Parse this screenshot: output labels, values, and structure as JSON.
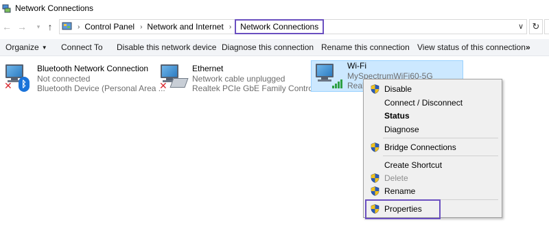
{
  "window": {
    "title": "Network Connections"
  },
  "address_bar": {
    "breadcrumbs": [
      "Control Panel",
      "Network and Internet",
      "Network Connections"
    ]
  },
  "toolbar": {
    "organize": "Organize",
    "connect_to": "Connect To",
    "disable_device": "Disable this network device",
    "diagnose": "Diagnose this connection",
    "rename": "Rename this connection",
    "view_status": "View status of this connection",
    "more": "»"
  },
  "connections": [
    {
      "name": "Bluetooth Network Connection",
      "status": "Not connected",
      "device": "Bluetooth Device (Personal Area ..."
    },
    {
      "name": "Ethernet",
      "status": "Network cable unplugged",
      "device": "Realtek PCIe GbE Family Controller"
    },
    {
      "name": "Wi-Fi",
      "status": "MySpectrumWiFi60-5G",
      "device": "Realt"
    }
  ],
  "context_menu": {
    "items": [
      {
        "label": "Disable",
        "shield": true
      },
      {
        "label": "Connect / Disconnect",
        "shield": false
      },
      {
        "label": "Status",
        "shield": false,
        "bold": true
      },
      {
        "label": "Diagnose",
        "shield": false
      },
      {
        "label": "Bridge Connections",
        "shield": true
      },
      {
        "label": "Create Shortcut",
        "shield": false
      },
      {
        "label": "Delete",
        "shield": true,
        "disabled": true
      },
      {
        "label": "Rename",
        "shield": true
      },
      {
        "label": "Properties",
        "shield": true,
        "highlighted": true
      }
    ]
  },
  "colors": {
    "highlight_border": "#6a4fc0",
    "selection_bg": "#cce8ff",
    "shield_blue": "#2b5cb8",
    "shield_yellow": "#f2c21b"
  }
}
